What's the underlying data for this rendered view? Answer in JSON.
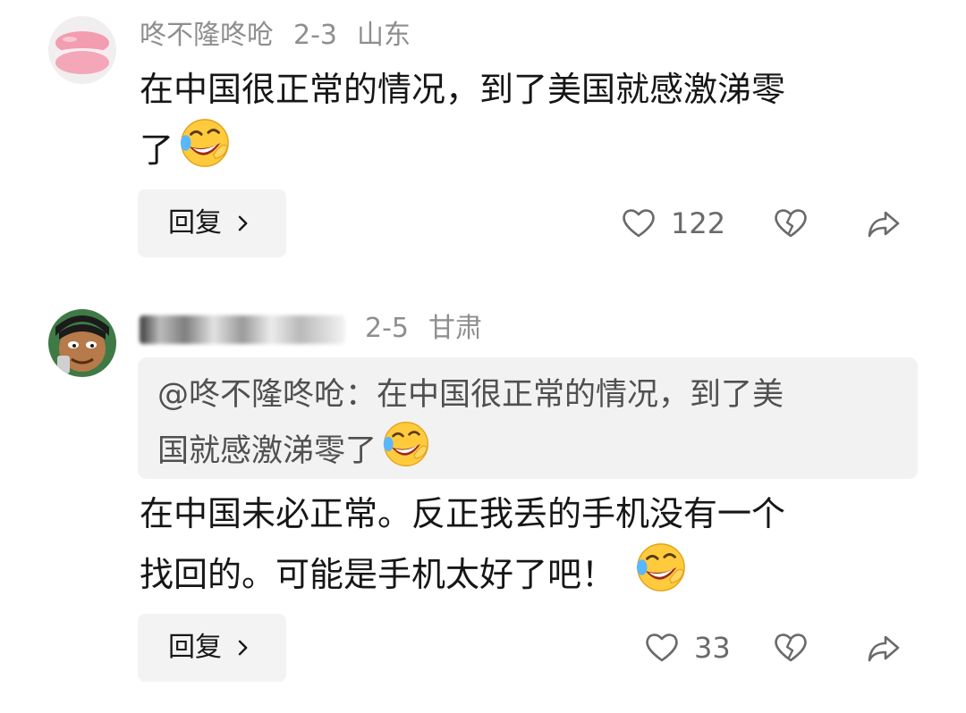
{
  "comments": [
    {
      "username": "咚不隆咚呛",
      "date": "2-3",
      "location": "山东",
      "text_line1": "在中国很正常的情况，到了美国就感激涕零",
      "text_line2": "了",
      "reply_label": "回复",
      "likes": "122",
      "avatar": "macaron-avatar"
    },
    {
      "username": "",
      "date": "2-5",
      "location": "甘肃",
      "quote_line1": "@咚不隆咚呛：在中国很正常的情况，到了美",
      "quote_line2": "国就感激涕零了",
      "text_line1": "在中国未必正常。反正我丢的手机没有一个",
      "text_line2": "找回的。可能是手机太好了吧！",
      "reply_label": "回复",
      "likes": "33",
      "avatar": "cartoon-avatar"
    }
  ],
  "icons": {
    "emoji": "laughing-tears-emoji",
    "like": "heart-outline-icon",
    "dislike": "broken-heart-icon",
    "share": "share-arrow-icon",
    "chevron": "chevron-right-icon"
  }
}
